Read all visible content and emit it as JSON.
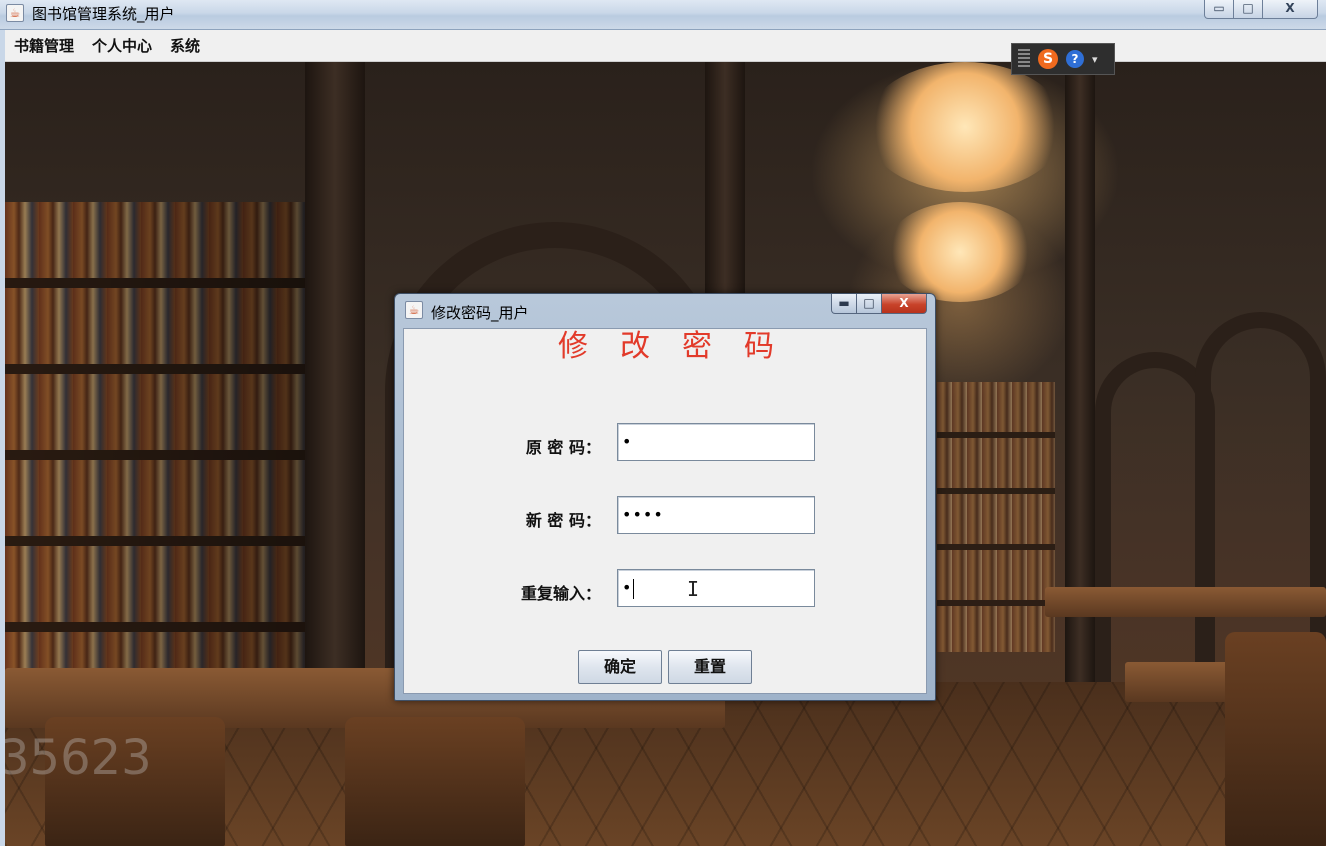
{
  "window": {
    "title": "图书馆管理系统_用户",
    "icon": "java-cup-icon",
    "controls": {
      "minimize": "▭",
      "maximize": "□",
      "close": "X"
    }
  },
  "menubar": {
    "items": [
      {
        "label": "书籍管理"
      },
      {
        "label": "个人中心"
      },
      {
        "label": "系统"
      }
    ]
  },
  "ime_toolbar": {
    "logo_label": "S",
    "help_label": "?",
    "arrow_label": "▾"
  },
  "watermark": "35623",
  "dialog": {
    "title": "修改密码_用户",
    "controls": {
      "minimize": "▬",
      "maximize": "□",
      "close": "X"
    },
    "heading": "修改密码",
    "fields": [
      {
        "label": "原 密 码：",
        "masked_value": "•"
      },
      {
        "label": "新 密 码：",
        "masked_value": "••••"
      },
      {
        "label": "重复输入：",
        "masked_value": "•"
      }
    ],
    "buttons": {
      "confirm": "确定",
      "reset": "重置"
    }
  },
  "colors": {
    "heading": "#e23a2a",
    "dialog_bg": "#f0f0f0",
    "close_button": "#c8432a"
  }
}
